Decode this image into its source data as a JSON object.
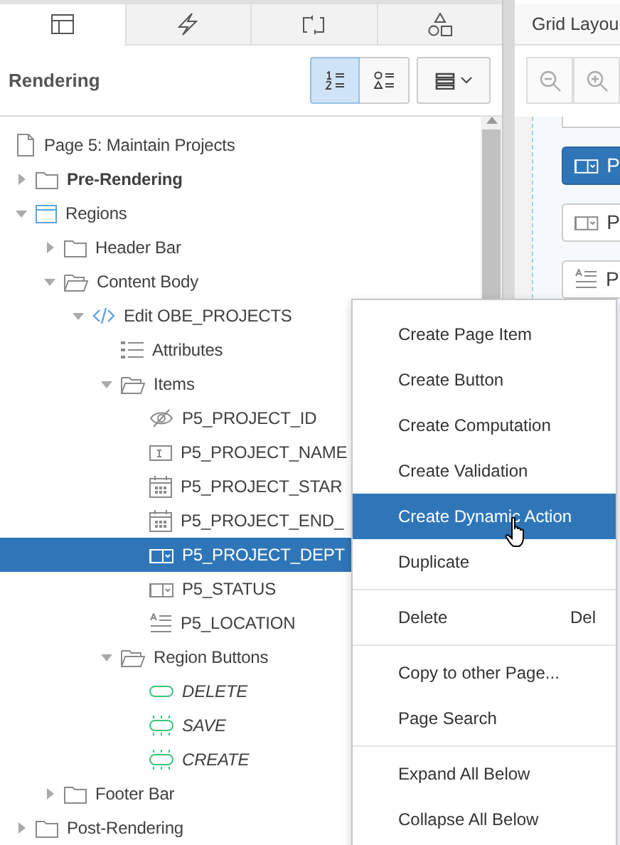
{
  "tabs": [
    {
      "kind": "layout",
      "selected": true
    },
    {
      "kind": "bolt",
      "selected": false
    },
    {
      "kind": "process",
      "selected": false
    },
    {
      "kind": "shapes",
      "selected": false
    }
  ],
  "panel": {
    "title": "Rendering",
    "view_buttons": [
      {
        "kind": "numbered",
        "selected": true
      },
      {
        "kind": "shapes-list",
        "selected": false
      }
    ]
  },
  "tree": [
    {
      "label": "Page 5: Maintain Projects",
      "kind": "page",
      "selected": false,
      "children": [
        {
          "label": "Pre-Rendering",
          "kind": "folder",
          "bold": true,
          "expanded": false,
          "selected": false
        },
        {
          "label": "Regions",
          "kind": "region",
          "expanded": true,
          "selected": false,
          "children": [
            {
              "label": "Header Bar",
              "kind": "folder",
              "expanded": false,
              "selected": false
            },
            {
              "label": "Content Body",
              "kind": "folder-open",
              "expanded": true,
              "selected": false,
              "children": [
                {
                  "label": "Edit OBE_PROJECTS",
                  "kind": "code",
                  "expanded": true,
                  "selected": false,
                  "children": [
                    {
                      "label": "Attributes",
                      "kind": "list",
                      "selected": false
                    },
                    {
                      "label": "Items",
                      "kind": "folder-open",
                      "expanded": true,
                      "selected": false,
                      "children": [
                        {
                          "label": "P5_PROJECT_ID",
                          "kind": "hidden",
                          "selected": false
                        },
                        {
                          "label": "P5_PROJECT_NAME",
                          "kind": "text-field",
                          "selected": false
                        },
                        {
                          "label": "P5_PROJECT_STAR",
                          "kind": "calendar",
                          "selected": false
                        },
                        {
                          "label": "P5_PROJECT_END_",
                          "kind": "calendar",
                          "selected": false
                        },
                        {
                          "label": "P5_PROJECT_DEPT",
                          "kind": "select",
                          "selected": true
                        },
                        {
                          "label": "P5_STATUS",
                          "kind": "select",
                          "selected": false
                        },
                        {
                          "label": "P5_LOCATION",
                          "kind": "textarea",
                          "selected": false
                        }
                      ]
                    },
                    {
                      "label": "Region Buttons",
                      "kind": "folder-open",
                      "expanded": true,
                      "selected": false,
                      "children": [
                        {
                          "label": "DELETE",
                          "kind": "button",
                          "selected": false
                        },
                        {
                          "label": "SAVE",
                          "kind": "button-dashed",
                          "selected": false
                        },
                        {
                          "label": "CREATE",
                          "kind": "button-dashed",
                          "selected": false
                        }
                      ]
                    }
                  ]
                }
              ]
            },
            {
              "label": "Footer Bar",
              "kind": "folder",
              "expanded": false,
              "selected": false
            }
          ]
        },
        {
          "label": "Post-Rendering",
          "kind": "folder",
          "expanded": false,
          "selected": false
        }
      ]
    }
  ],
  "right_panel": {
    "tab": "Grid Layou",
    "cards": [
      {
        "label": "P",
        "kind": "select",
        "selected": true
      },
      {
        "label": "P",
        "kind": "select",
        "selected": false
      },
      {
        "label": "P",
        "kind": "textarea",
        "selected": false
      }
    ]
  },
  "context_menu": [
    [
      {
        "label": "Create Page Item",
        "selected": false
      },
      {
        "label": "Create Button",
        "selected": false
      },
      {
        "label": "Create Computation",
        "selected": false
      },
      {
        "label": "Create Validation",
        "selected": false
      },
      {
        "label": "Create Dynamic Action",
        "selected": true
      },
      {
        "label": "Duplicate",
        "selected": false
      }
    ],
    [
      {
        "label": "Delete",
        "shortcut": "Del",
        "selected": false
      }
    ],
    [
      {
        "label": "Copy to other Page...",
        "selected": false
      },
      {
        "label": "Page Search",
        "selected": false
      }
    ],
    [
      {
        "label": "Expand All Below",
        "selected": false
      },
      {
        "label": "Collapse All Below",
        "selected": false
      }
    ]
  ]
}
